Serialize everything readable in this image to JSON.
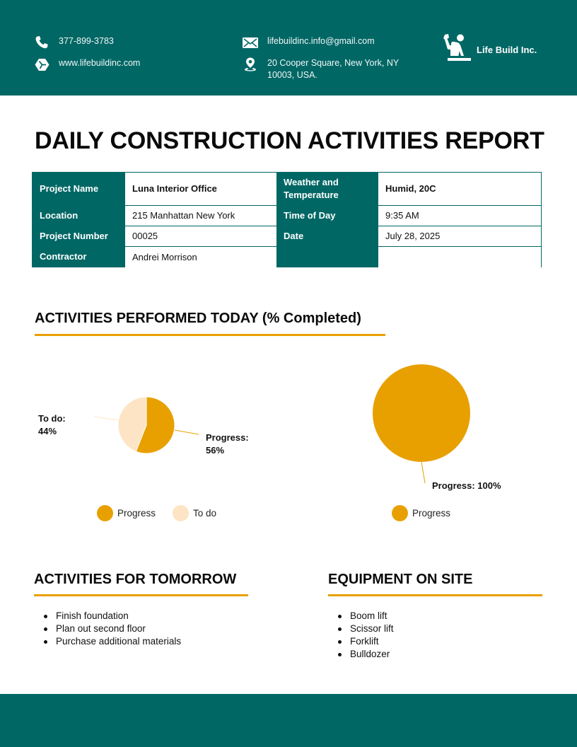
{
  "colors": {
    "brand_teal": "#016765",
    "accent_orange": "#E8A000",
    "light_peach": "#FDE4C4"
  },
  "header": {
    "phone": {
      "icon": "phone-icon",
      "text": "377-899-3783"
    },
    "website": {
      "icon": "website-icon",
      "text": "www.lifebuildinc.com"
    },
    "email": {
      "icon": "envelope-icon",
      "text": "lifebuildinc.info@gmail.com"
    },
    "address": {
      "icon": "location-pin-icon",
      "text": "20 Cooper Square, New York, NY 10003, USA."
    },
    "brand": {
      "icon": "worker-logo-icon",
      "name": "Life Build Inc."
    }
  },
  "title": "DAILY CONSTRUCTION ACTIVITIES REPORT",
  "info_table": {
    "left": [
      {
        "label": "Project Name",
        "value": "Luna Interior Office"
      },
      {
        "label": "Location",
        "value": "215 Manhattan New York"
      },
      {
        "label": "Project Number",
        "value": "00025"
      },
      {
        "label": "Contractor",
        "value": "Andrei Morrison"
      }
    ],
    "right": [
      {
        "label": "Weather and Temperature",
        "value": "Humid, 20C"
      },
      {
        "label": "Time of Day",
        "value": "9:35 AM"
      },
      {
        "label": "Date",
        "value": "July 28, 2025"
      },
      {
        "label": "",
        "value": ""
      }
    ]
  },
  "activities_today": {
    "heading": "ACTIVITIES PERFORMED TODAY (% Completed)"
  },
  "chart_data": [
    {
      "type": "pie",
      "title": "",
      "categories": [
        "Progress",
        "To do"
      ],
      "values": [
        56,
        44
      ],
      "unit": "%",
      "colors": [
        "#E8A000",
        "#FDE4C4"
      ],
      "data_labels": [
        "Progress:",
        "56%",
        "To do:",
        "44%"
      ],
      "legend": [
        "Progress",
        "To do"
      ],
      "legend_position": "bottom"
    },
    {
      "type": "pie",
      "title": "",
      "categories": [
        "Progress"
      ],
      "values": [
        100
      ],
      "unit": "%",
      "colors": [
        "#E8A000"
      ],
      "data_labels": [
        "Progress: 100%"
      ],
      "legend": [
        "Progress"
      ],
      "legend_position": "bottom"
    }
  ],
  "tomorrow": {
    "heading": "ACTIVITIES FOR TOMORROW",
    "items": [
      "Finish foundation",
      "Plan out second floor",
      "Purchase additional materials"
    ]
  },
  "equipment": {
    "heading": "EQUIPMENT ON SITE",
    "items": [
      "Boom lift",
      "Scissor lift",
      "Forklift",
      "Bulldozer"
    ]
  }
}
